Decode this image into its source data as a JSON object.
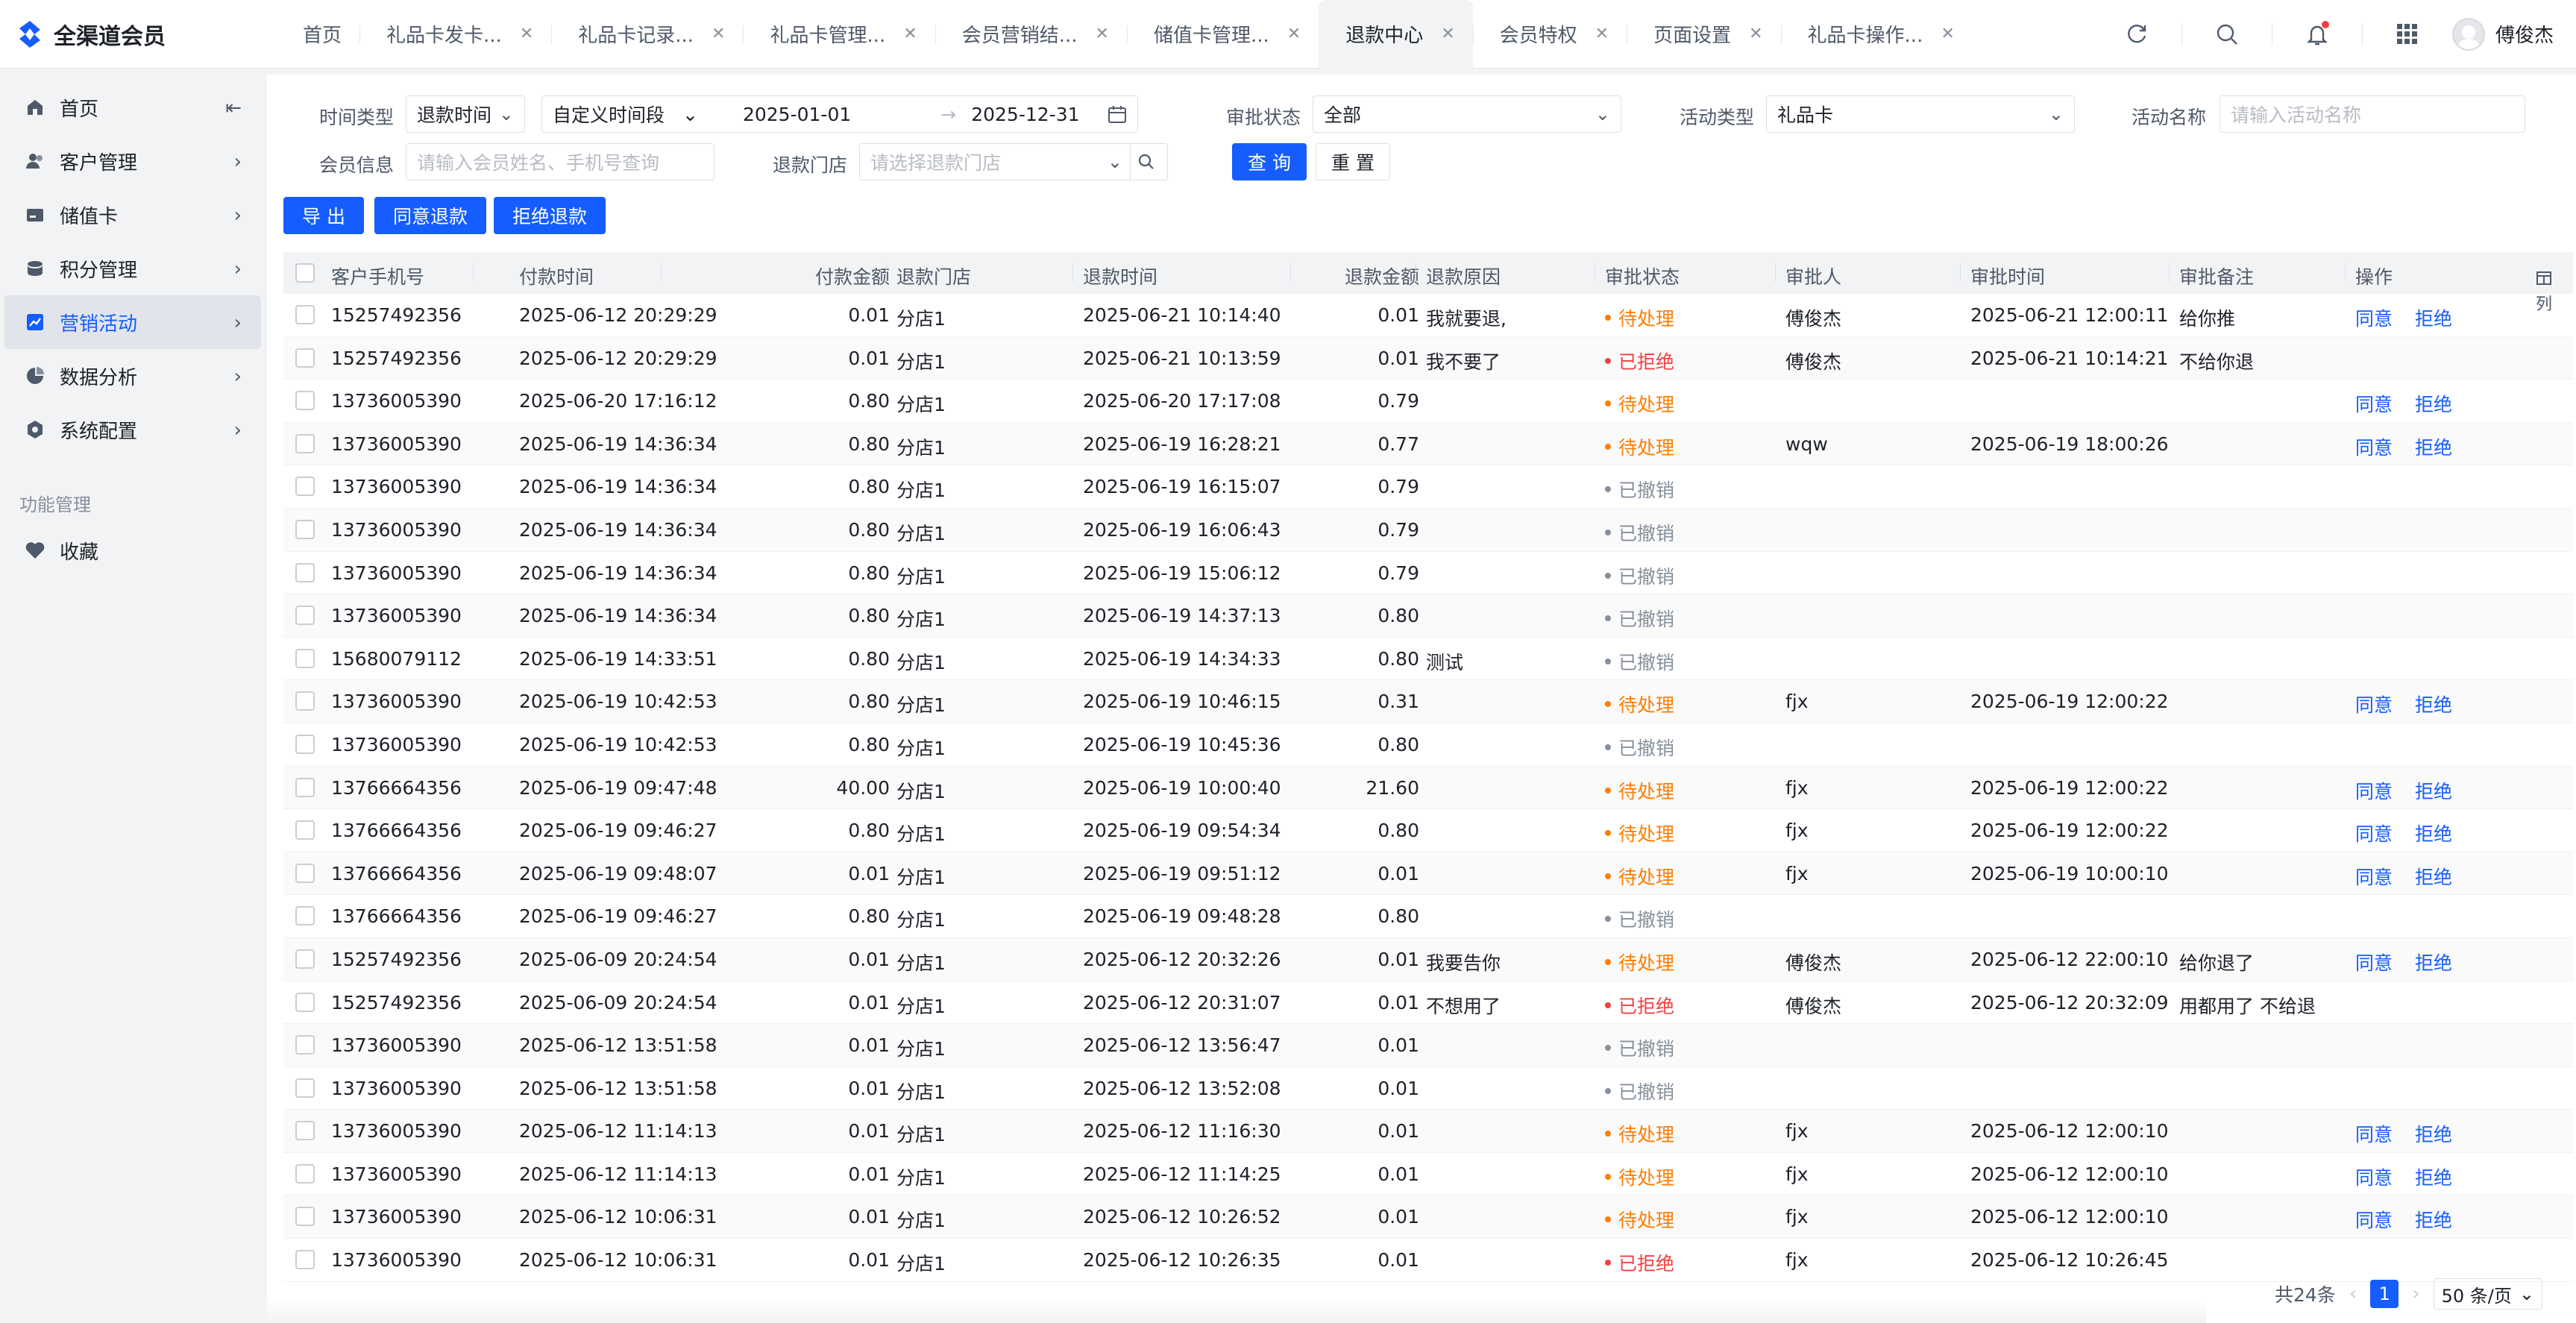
{
  "app": {
    "title": "全渠道会员"
  },
  "tabs": [
    {
      "label": "首页",
      "closable": false,
      "active": false
    },
    {
      "label": "礼品卡发卡...",
      "closable": true,
      "active": false
    },
    {
      "label": "礼品卡记录...",
      "closable": true,
      "active": false
    },
    {
      "label": "礼品卡管理...",
      "closable": true,
      "active": false
    },
    {
      "label": "会员营销结...",
      "closable": true,
      "active": false
    },
    {
      "label": "储值卡管理...",
      "closable": true,
      "active": false
    },
    {
      "label": "退款中心",
      "closable": true,
      "active": true
    },
    {
      "label": "会员特权",
      "closable": true,
      "active": false
    },
    {
      "label": "页面设置",
      "closable": true,
      "active": false
    },
    {
      "label": "礼品卡操作...",
      "closable": true,
      "active": false
    }
  ],
  "user": {
    "name": "傅俊杰"
  },
  "sidebar": {
    "items": [
      {
        "label": "首页",
        "icon": "home-icon",
        "active": false
      },
      {
        "label": "客户管理",
        "icon": "users-icon",
        "active": false
      },
      {
        "label": "储值卡",
        "icon": "card-icon",
        "active": false
      },
      {
        "label": "积分管理",
        "icon": "points-icon",
        "active": false
      },
      {
        "label": "营销活动",
        "icon": "chart-icon",
        "active": true
      },
      {
        "label": "数据分析",
        "icon": "pie-icon",
        "active": false
      },
      {
        "label": "系统配置",
        "icon": "settings-icon",
        "active": false
      }
    ],
    "section_title": "功能管理",
    "favorites_label": "收藏"
  },
  "filters": {
    "time_type_label": "时间类型",
    "time_type_value": "退款时间",
    "range_mode_value": "自定义时间段",
    "date_start": "2025-01-01",
    "date_arrow": "→",
    "date_end": "2025-12-31",
    "approval_status_label": "审批状态",
    "approval_status_value": "全部",
    "activity_type_label": "活动类型",
    "activity_type_value": "礼品卡",
    "activity_name_label": "活动名称",
    "activity_name_placeholder": "请输入活动名称",
    "member_info_label": "会员信息",
    "member_info_placeholder": "请输入会员姓名、手机号查询",
    "store_label": "退款门店",
    "store_placeholder": "请选择退款门店",
    "query_button": "查 询",
    "reset_button": "重 置"
  },
  "actions": {
    "export": "导 出",
    "approve_refund": "同意退款",
    "reject_refund": "拒绝退款"
  },
  "table": {
    "columns": [
      "客户手机号",
      "付款时间",
      "付款金额",
      "退款门店",
      "退款时间",
      "退款金额",
      "退款原因",
      "审批状态",
      "审批人",
      "审批时间",
      "审批备注",
      "操作"
    ],
    "column_toggle_label": "列",
    "rows": [
      {
        "phone": "15257492356",
        "pay_time": "2025-06-12 20:29:29",
        "pay_amount": "0.01",
        "store": "分店1",
        "refund_time": "2025-06-21 10:14:40",
        "refund_amount": "0.01",
        "reason": "我就要退,",
        "status": "待处理",
        "status_kind": "pending",
        "approver": "傅俊杰",
        "approve_time": "2025-06-21 12:00:11",
        "remark": "给你推",
        "op1": "同意",
        "op2": "拒绝"
      },
      {
        "phone": "15257492356",
        "pay_time": "2025-06-12 20:29:29",
        "pay_amount": "0.01",
        "store": "分店1",
        "refund_time": "2025-06-21 10:13:59",
        "refund_amount": "0.01",
        "reason": "我不要了",
        "status": "已拒绝",
        "status_kind": "rejected",
        "approver": "傅俊杰",
        "approve_time": "2025-06-21 10:14:21",
        "remark": "不给你退",
        "op1": "",
        "op2": ""
      },
      {
        "phone": "13736005390",
        "pay_time": "2025-06-20 17:16:12",
        "pay_amount": "0.80",
        "store": "分店1",
        "refund_time": "2025-06-20 17:17:08",
        "refund_amount": "0.79",
        "reason": "",
        "status": "待处理",
        "status_kind": "pending",
        "approver": "",
        "approve_time": "",
        "remark": "",
        "op1": "同意",
        "op2": "拒绝"
      },
      {
        "phone": "13736005390",
        "pay_time": "2025-06-19 14:36:34",
        "pay_amount": "0.80",
        "store": "分店1",
        "refund_time": "2025-06-19 16:28:21",
        "refund_amount": "0.77",
        "reason": "",
        "status": "待处理",
        "status_kind": "pending",
        "approver": "wqw",
        "approve_time": "2025-06-19 18:00:26",
        "remark": "",
        "op1": "同意",
        "op2": "拒绝"
      },
      {
        "phone": "13736005390",
        "pay_time": "2025-06-19 14:36:34",
        "pay_amount": "0.80",
        "store": "分店1",
        "refund_time": "2025-06-19 16:15:07",
        "refund_amount": "0.79",
        "reason": "",
        "status": "已撤销",
        "status_kind": "cancelled",
        "approver": "",
        "approve_time": "",
        "remark": "",
        "op1": "",
        "op2": ""
      },
      {
        "phone": "13736005390",
        "pay_time": "2025-06-19 14:36:34",
        "pay_amount": "0.80",
        "store": "分店1",
        "refund_time": "2025-06-19 16:06:43",
        "refund_amount": "0.79",
        "reason": "",
        "status": "已撤销",
        "status_kind": "cancelled",
        "approver": "",
        "approve_time": "",
        "remark": "",
        "op1": "",
        "op2": ""
      },
      {
        "phone": "13736005390",
        "pay_time": "2025-06-19 14:36:34",
        "pay_amount": "0.80",
        "store": "分店1",
        "refund_time": "2025-06-19 15:06:12",
        "refund_amount": "0.79",
        "reason": "",
        "status": "已撤销",
        "status_kind": "cancelled",
        "approver": "",
        "approve_time": "",
        "remark": "",
        "op1": "",
        "op2": ""
      },
      {
        "phone": "13736005390",
        "pay_time": "2025-06-19 14:36:34",
        "pay_amount": "0.80",
        "store": "分店1",
        "refund_time": "2025-06-19 14:37:13",
        "refund_amount": "0.80",
        "reason": "",
        "status": "已撤销",
        "status_kind": "cancelled",
        "approver": "",
        "approve_time": "",
        "remark": "",
        "op1": "",
        "op2": ""
      },
      {
        "phone": "15680079112",
        "pay_time": "2025-06-19 14:33:51",
        "pay_amount": "0.80",
        "store": "分店1",
        "refund_time": "2025-06-19 14:34:33",
        "refund_amount": "0.80",
        "reason": "测试",
        "status": "已撤销",
        "status_kind": "cancelled",
        "approver": "",
        "approve_time": "",
        "remark": "",
        "op1": "",
        "op2": ""
      },
      {
        "phone": "13736005390",
        "pay_time": "2025-06-19 10:42:53",
        "pay_amount": "0.80",
        "store": "分店1",
        "refund_time": "2025-06-19 10:46:15",
        "refund_amount": "0.31",
        "reason": "",
        "status": "待处理",
        "status_kind": "pending",
        "approver": "fjx",
        "approve_time": "2025-06-19 12:00:22",
        "remark": "",
        "op1": "同意",
        "op2": "拒绝"
      },
      {
        "phone": "13736005390",
        "pay_time": "2025-06-19 10:42:53",
        "pay_amount": "0.80",
        "store": "分店1",
        "refund_time": "2025-06-19 10:45:36",
        "refund_amount": "0.80",
        "reason": "",
        "status": "已撤销",
        "status_kind": "cancelled",
        "approver": "",
        "approve_time": "",
        "remark": "",
        "op1": "",
        "op2": ""
      },
      {
        "phone": "13766664356",
        "pay_time": "2025-06-19 09:47:48",
        "pay_amount": "40.00",
        "store": "分店1",
        "refund_time": "2025-06-19 10:00:40",
        "refund_amount": "21.60",
        "reason": "",
        "status": "待处理",
        "status_kind": "pending",
        "approver": "fjx",
        "approve_time": "2025-06-19 12:00:22",
        "remark": "",
        "op1": "同意",
        "op2": "拒绝"
      },
      {
        "phone": "13766664356",
        "pay_time": "2025-06-19 09:46:27",
        "pay_amount": "0.80",
        "store": "分店1",
        "refund_time": "2025-06-19 09:54:34",
        "refund_amount": "0.80",
        "reason": "",
        "status": "待处理",
        "status_kind": "pending",
        "approver": "fjx",
        "approve_time": "2025-06-19 12:00:22",
        "remark": "",
        "op1": "同意",
        "op2": "拒绝"
      },
      {
        "phone": "13766664356",
        "pay_time": "2025-06-19 09:48:07",
        "pay_amount": "0.01",
        "store": "分店1",
        "refund_time": "2025-06-19 09:51:12",
        "refund_amount": "0.01",
        "reason": "",
        "status": "待处理",
        "status_kind": "pending",
        "approver": "fjx",
        "approve_time": "2025-06-19 10:00:10",
        "remark": "",
        "op1": "同意",
        "op2": "拒绝"
      },
      {
        "phone": "13766664356",
        "pay_time": "2025-06-19 09:46:27",
        "pay_amount": "0.80",
        "store": "分店1",
        "refund_time": "2025-06-19 09:48:28",
        "refund_amount": "0.80",
        "reason": "",
        "status": "已撤销",
        "status_kind": "cancelled",
        "approver": "",
        "approve_time": "",
        "remark": "",
        "op1": "",
        "op2": ""
      },
      {
        "phone": "15257492356",
        "pay_time": "2025-06-09 20:24:54",
        "pay_amount": "0.01",
        "store": "分店1",
        "refund_time": "2025-06-12 20:32:26",
        "refund_amount": "0.01",
        "reason": "我要告你",
        "status": "待处理",
        "status_kind": "pending",
        "approver": "傅俊杰",
        "approve_time": "2025-06-12 22:00:10",
        "remark": "给你退了",
        "op1": "同意",
        "op2": "拒绝"
      },
      {
        "phone": "15257492356",
        "pay_time": "2025-06-09 20:24:54",
        "pay_amount": "0.01",
        "store": "分店1",
        "refund_time": "2025-06-12 20:31:07",
        "refund_amount": "0.01",
        "reason": "不想用了",
        "status": "已拒绝",
        "status_kind": "rejected",
        "approver": "傅俊杰",
        "approve_time": "2025-06-12 20:32:09",
        "remark": "用都用了 不给退",
        "op1": "",
        "op2": ""
      },
      {
        "phone": "13736005390",
        "pay_time": "2025-06-12 13:51:58",
        "pay_amount": "0.01",
        "store": "分店1",
        "refund_time": "2025-06-12 13:56:47",
        "refund_amount": "0.01",
        "reason": "",
        "status": "已撤销",
        "status_kind": "cancelled",
        "approver": "",
        "approve_time": "",
        "remark": "",
        "op1": "",
        "op2": ""
      },
      {
        "phone": "13736005390",
        "pay_time": "2025-06-12 13:51:58",
        "pay_amount": "0.01",
        "store": "分店1",
        "refund_time": "2025-06-12 13:52:08",
        "refund_amount": "0.01",
        "reason": "",
        "status": "已撤销",
        "status_kind": "cancelled",
        "approver": "",
        "approve_time": "",
        "remark": "",
        "op1": "",
        "op2": ""
      },
      {
        "phone": "13736005390",
        "pay_time": "2025-06-12 11:14:13",
        "pay_amount": "0.01",
        "store": "分店1",
        "refund_time": "2025-06-12 11:16:30",
        "refund_amount": "0.01",
        "reason": "",
        "status": "待处理",
        "status_kind": "pending",
        "approver": "fjx",
        "approve_time": "2025-06-12 12:00:10",
        "remark": "",
        "op1": "同意",
        "op2": "拒绝"
      },
      {
        "phone": "13736005390",
        "pay_time": "2025-06-12 11:14:13",
        "pay_amount": "0.01",
        "store": "分店1",
        "refund_time": "2025-06-12 11:14:25",
        "refund_amount": "0.01",
        "reason": "",
        "status": "待处理",
        "status_kind": "pending",
        "approver": "fjx",
        "approve_time": "2025-06-12 12:00:10",
        "remark": "",
        "op1": "同意",
        "op2": "拒绝"
      },
      {
        "phone": "13736005390",
        "pay_time": "2025-06-12 10:06:31",
        "pay_amount": "0.01",
        "store": "分店1",
        "refund_time": "2025-06-12 10:26:52",
        "refund_amount": "0.01",
        "reason": "",
        "status": "待处理",
        "status_kind": "pending",
        "approver": "fjx",
        "approve_time": "2025-06-12 12:00:10",
        "remark": "",
        "op1": "同意",
        "op2": "拒绝"
      },
      {
        "phone": "13736005390",
        "pay_time": "2025-06-12 10:06:31",
        "pay_amount": "0.01",
        "store": "分店1",
        "refund_time": "2025-06-12 10:26:35",
        "refund_amount": "0.01",
        "reason": "",
        "status": "已拒绝",
        "status_kind": "rejected",
        "approver": "fjx",
        "approve_time": "2025-06-12 10:26:45",
        "remark": "",
        "op1": "",
        "op2": ""
      }
    ]
  },
  "pagination": {
    "total_text": "共24条",
    "current_page": "1",
    "page_size": "50 条/页"
  },
  "colors": {
    "primary": "#165dff",
    "pending": "#ff7d00",
    "rejected": "#f53f3f",
    "cancelled": "#86909c"
  }
}
